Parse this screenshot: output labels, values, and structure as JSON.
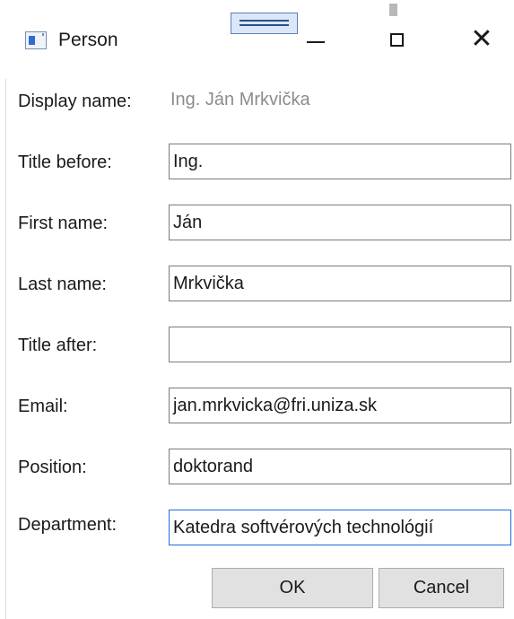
{
  "window": {
    "title": "Person",
    "controls": {
      "minimize": "—",
      "maximize": "□",
      "close": "✕"
    },
    "icons": {
      "app": "app-window-icon",
      "grip": "drag-handle-icon"
    }
  },
  "form": {
    "display_name": {
      "label": "Display name:",
      "value": "Ing. Ján Mrkvička"
    },
    "title_before": {
      "label": "Title before:",
      "value": "Ing."
    },
    "first_name": {
      "label": "First name:",
      "value": "Ján"
    },
    "last_name": {
      "label": "Last name:",
      "value": "Mrkvička"
    },
    "title_after": {
      "label": "Title after:",
      "value": ""
    },
    "email": {
      "label": "Email:",
      "value": "jan.mrkvicka@fri.uniza.sk"
    },
    "position": {
      "label": "Position:",
      "value": "doktorand"
    },
    "department": {
      "label": "Department:",
      "value": "Katedra softvérových technológií"
    }
  },
  "buttons": {
    "ok": "OK",
    "cancel": "Cancel"
  },
  "colors": {
    "focus_border": "#1f6ed6",
    "readonly_text": "#8c8c8c",
    "button_bg": "#e1e1e1"
  }
}
